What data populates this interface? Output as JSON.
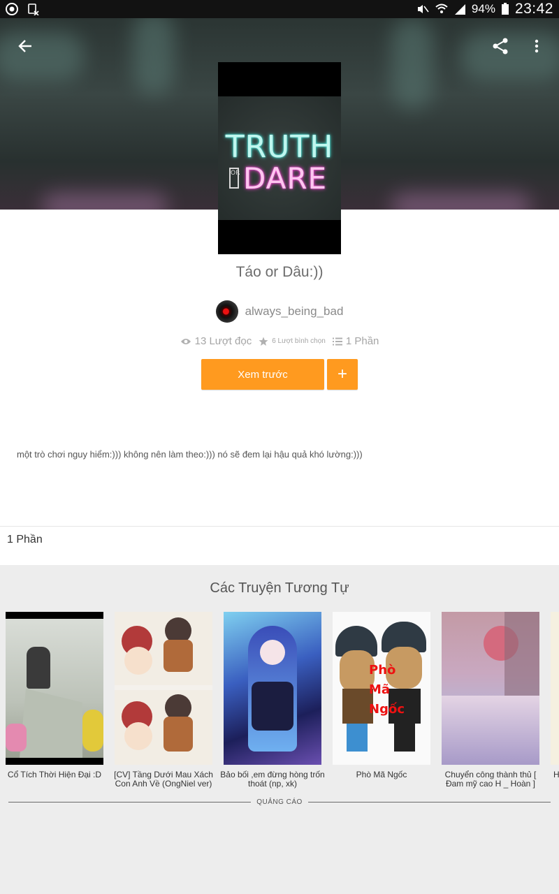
{
  "status_bar": {
    "battery": "94%",
    "time": "23:42"
  },
  "cover": {
    "line1": "TRUTH",
    "or": "OR",
    "line2": "DARE"
  },
  "story": {
    "title": "Táo or Dâu:))",
    "author": "always_being_bad",
    "reads": "13 Lượt đọc",
    "votes": "6 Lượt bình chọn",
    "parts": "1 Phần",
    "preview_label": "Xem trước",
    "add_label": "+",
    "description": "một trò chơi nguy hiểm:))) không nên làm theo:))) nó sẽ đem lại hậu quả khó lường:)))"
  },
  "parts_section": {
    "label": "1 Phần"
  },
  "similar": {
    "title": "Các Truyện Tương Tự",
    "items": [
      {
        "title": "Cổ Tích Thời Hiện Đại :D"
      },
      {
        "title": "[CV] Tầng Dưới Mau Xách Con Anh Về (OngNiel ver)"
      },
      {
        "title": "Bảo bối ,em đừng hòng trốn thoát (np, xk)"
      },
      {
        "title": "Phò Mã Ngốc"
      },
      {
        "title": "Chuyển công thành thủ [ Đam mỹ cao H _ Hoàn ]"
      },
      {
        "title": "H"
      }
    ],
    "ad_label": "QUẢNG CÁO"
  },
  "colors": {
    "accent": "#ff9a1f",
    "status_bar": "#121212"
  }
}
